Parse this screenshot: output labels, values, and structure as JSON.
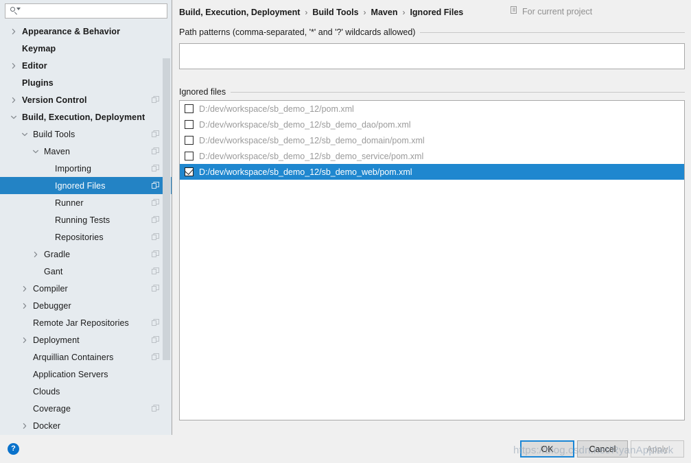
{
  "search": {
    "value": "",
    "placeholder": "",
    "icon": "search-icon"
  },
  "sidebar": {
    "items": [
      {
        "label": "Appearance & Behavior",
        "indent": 0,
        "chevron": "right",
        "bold": true,
        "badge": false,
        "selected": false
      },
      {
        "label": "Keymap",
        "indent": 0,
        "chevron": "none",
        "bold": true,
        "badge": false,
        "selected": false
      },
      {
        "label": "Editor",
        "indent": 0,
        "chevron": "right",
        "bold": true,
        "badge": false,
        "selected": false
      },
      {
        "label": "Plugins",
        "indent": 0,
        "chevron": "none",
        "bold": true,
        "badge": false,
        "selected": false
      },
      {
        "label": "Version Control",
        "indent": 0,
        "chevron": "right",
        "bold": true,
        "badge": true,
        "selected": false
      },
      {
        "label": "Build, Execution, Deployment",
        "indent": 0,
        "chevron": "down",
        "bold": true,
        "badge": false,
        "selected": false
      },
      {
        "label": "Build Tools",
        "indent": 1,
        "chevron": "down",
        "bold": false,
        "badge": true,
        "selected": false
      },
      {
        "label": "Maven",
        "indent": 2,
        "chevron": "down",
        "bold": false,
        "badge": true,
        "selected": false
      },
      {
        "label": "Importing",
        "indent": 3,
        "chevron": "none",
        "bold": false,
        "badge": true,
        "selected": false
      },
      {
        "label": "Ignored Files",
        "indent": 3,
        "chevron": "none",
        "bold": false,
        "badge": true,
        "selected": true
      },
      {
        "label": "Runner",
        "indent": 3,
        "chevron": "none",
        "bold": false,
        "badge": true,
        "selected": false
      },
      {
        "label": "Running Tests",
        "indent": 3,
        "chevron": "none",
        "bold": false,
        "badge": true,
        "selected": false
      },
      {
        "label": "Repositories",
        "indent": 3,
        "chevron": "none",
        "bold": false,
        "badge": true,
        "selected": false
      },
      {
        "label": "Gradle",
        "indent": 2,
        "chevron": "right",
        "bold": false,
        "badge": true,
        "selected": false
      },
      {
        "label": "Gant",
        "indent": 2,
        "chevron": "none",
        "bold": false,
        "badge": true,
        "selected": false
      },
      {
        "label": "Compiler",
        "indent": 1,
        "chevron": "right",
        "bold": false,
        "badge": true,
        "selected": false
      },
      {
        "label": "Debugger",
        "indent": 1,
        "chevron": "right",
        "bold": false,
        "badge": false,
        "selected": false
      },
      {
        "label": "Remote Jar Repositories",
        "indent": 1,
        "chevron": "none",
        "bold": false,
        "badge": true,
        "selected": false
      },
      {
        "label": "Deployment",
        "indent": 1,
        "chevron": "right",
        "bold": false,
        "badge": true,
        "selected": false
      },
      {
        "label": "Arquillian Containers",
        "indent": 1,
        "chevron": "none",
        "bold": false,
        "badge": true,
        "selected": false
      },
      {
        "label": "Application Servers",
        "indent": 1,
        "chevron": "none",
        "bold": false,
        "badge": false,
        "selected": false
      },
      {
        "label": "Clouds",
        "indent": 1,
        "chevron": "none",
        "bold": false,
        "badge": false,
        "selected": false
      },
      {
        "label": "Coverage",
        "indent": 1,
        "chevron": "none",
        "bold": false,
        "badge": true,
        "selected": false
      },
      {
        "label": "Docker",
        "indent": 1,
        "chevron": "right",
        "bold": false,
        "badge": false,
        "selected": false
      }
    ]
  },
  "header": {
    "breadcrumb": [
      "Build, Execution, Deployment",
      "Build Tools",
      "Maven",
      "Ignored Files"
    ],
    "separator": "›",
    "scope_label": "For current project",
    "scope_icon": "copy-icon"
  },
  "main": {
    "pattern_group_label": "Path patterns (comma-separated, '*' and '?' wildcards allowed)",
    "pattern_value": "",
    "pattern_placeholder": "",
    "files_group_label": "Ignored files",
    "files": [
      {
        "path": "D:/dev/workspace/sb_demo_12/pom.xml",
        "checked": false,
        "selected": false
      },
      {
        "path": "D:/dev/workspace/sb_demo_12/sb_demo_dao/pom.xml",
        "checked": false,
        "selected": false
      },
      {
        "path": "D:/dev/workspace/sb_demo_12/sb_demo_domain/pom.xml",
        "checked": false,
        "selected": false
      },
      {
        "path": "D:/dev/workspace/sb_demo_12/sb_demo_service/pom.xml",
        "checked": false,
        "selected": false
      },
      {
        "path": "D:/dev/workspace/sb_demo_12/sb_demo_web/pom.xml",
        "checked": true,
        "selected": true
      }
    ]
  },
  "footer": {
    "help_label": "?",
    "ok_label": "OK",
    "cancel_label": "Cancel",
    "apply_label": "Apply"
  },
  "watermark": {
    "text": "https://blog.csdn.net/RyanApplack"
  },
  "colors": {
    "selection_blue": "#2383c5",
    "row_selection_blue": "#1f87cf",
    "focus_border": "#1a86d6",
    "sidebar_bg": "#e6ebef",
    "panel_bg": "#f0f0f0",
    "help_blue": "#0a72cb"
  }
}
